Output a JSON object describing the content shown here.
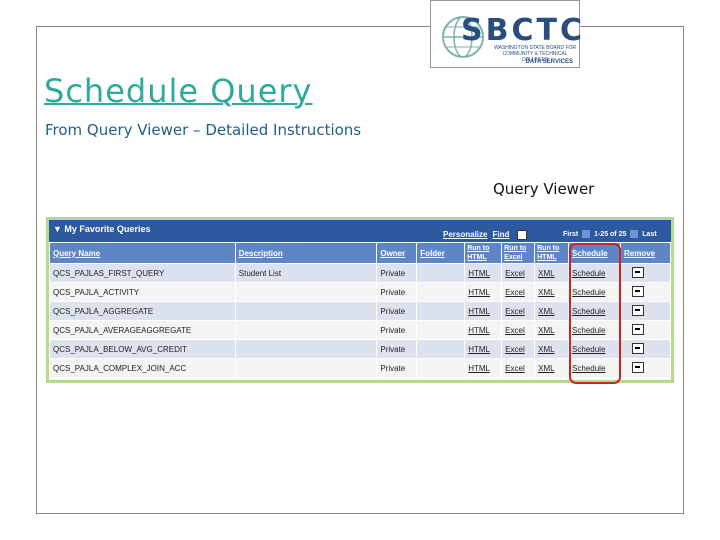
{
  "logo": {
    "text": "SBCTC",
    "subtitle": "WASHINGTON STATE BOARD FOR COMMUNITY & TECHNICAL COLLEGES",
    "tagline": "DATA SERVICES",
    "colors": {
      "primary": "#2a4d7f",
      "accent": "#1e7f7a"
    }
  },
  "slide": {
    "title": "Schedule Query ",
    "subtitle": "From Query Viewer – Detailed Instructions",
    "caption": "Query Viewer",
    "title_color": "#2eaa9a",
    "subtitle_color": "#1f5f8b"
  },
  "panel": {
    "title": "My Favorite Queries",
    "header_links": [
      "Personalize",
      "Find"
    ],
    "pager": {
      "first": "First",
      "range": "1-25 of 25",
      "last": "Last"
    },
    "columns": [
      "Query Name",
      "Description",
      "Owner",
      "Folder",
      "Run to HTML",
      "Run to Excel",
      "Run to HTML",
      "Schedule",
      "Remove"
    ],
    "rows": [
      {
        "name": "QCS_PAJLAS_FIRST_QUERY",
        "description": "Student List",
        "owner": "Private",
        "folder": "",
        "html": "HTML",
        "excel": "Excel",
        "xml": "XML",
        "schedule": "Schedule"
      },
      {
        "name": "QCS_PAJLA_ACTIVITY",
        "description": "",
        "owner": "Private",
        "folder": "",
        "html": "HTML",
        "excel": "Excel",
        "xml": "XML",
        "schedule": "Schedule"
      },
      {
        "name": "QCS_PAJLA_AGGREGATE",
        "description": "",
        "owner": "Private",
        "folder": "",
        "html": "HTML",
        "excel": "Excel",
        "xml": "XML",
        "schedule": "Schedule"
      },
      {
        "name": "QCS_PAJLA_AVERAGEAGGREGATE",
        "description": "",
        "owner": "Private",
        "folder": "",
        "html": "HTML",
        "excel": "Excel",
        "xml": "XML",
        "schedule": "Schedule"
      },
      {
        "name": "QCS_PAJLA_BELOW_AVG_CREDIT",
        "description": "",
        "owner": "Private",
        "folder": "",
        "html": "HTML",
        "excel": "Excel",
        "xml": "XML",
        "schedule": "Schedule"
      },
      {
        "name": "QCS_PAJLA_COMPLEX_JOIN_ACC",
        "description": "",
        "owner": "Private",
        "folder": "",
        "html": "HTML",
        "excel": "Excel",
        "xml": "XML",
        "schedule": "Schedule"
      }
    ],
    "colors": {
      "header": "#2d5a9e",
      "column_header": "#5f86c4",
      "row_odd": "#dde3ee",
      "row_even": "#f4f4f4",
      "highlight": "#d21f1f",
      "border": "#b7d98a"
    }
  }
}
